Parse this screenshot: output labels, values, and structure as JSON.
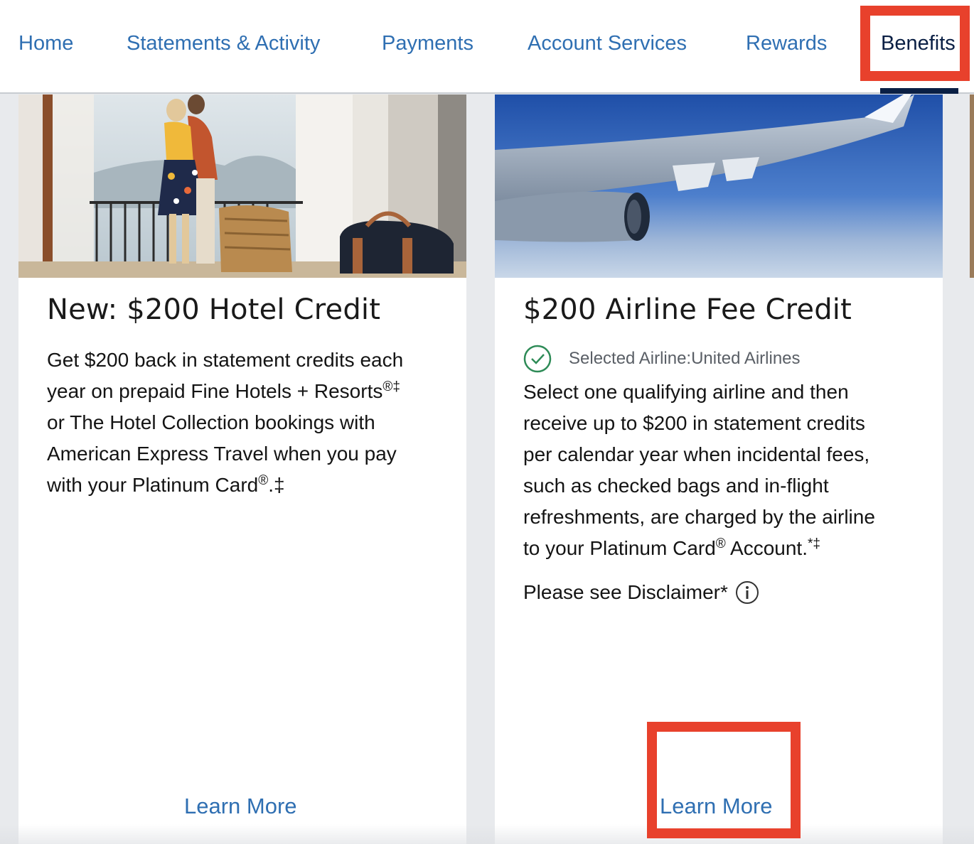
{
  "nav": {
    "items": [
      {
        "label": "Home"
      },
      {
        "label": "Statements & Activity"
      },
      {
        "label": "Payments"
      },
      {
        "label": "Account Services"
      },
      {
        "label": "Rewards"
      },
      {
        "label": "Benefits",
        "active": true
      }
    ]
  },
  "cards": [
    {
      "image": "couple-on-hotel-balcony-photo",
      "title": "New: $200 Hotel Credit",
      "body_lines": [
        "Get $200 back in statement credits each",
        "year on prepaid Fine Hotels + Resorts",
        "®‡",
        "or The Hotel Collection bookings with",
        "American Express Travel when you pay",
        "with your Platinum Card",
        "®",
        ".‡"
      ],
      "learn_more": "Learn More"
    },
    {
      "image": "airplane-wing-photo",
      "title": "$200 Airline Fee Credit",
      "selected_airline": "Selected Airline:United Airlines",
      "body_lines": [
        "Select one qualifying airline and then",
        "receive up to $200 in statement credits",
        "per calendar year when incidental fees,",
        "such as checked bags and in-flight",
        "refreshments, are charged by the airline",
        "to your Platinum Card",
        "®",
        " Account.",
        "*‡"
      ],
      "disclaimer": "Please see Disclaimer*",
      "learn_more": "Learn More"
    }
  ],
  "colors": {
    "link": "#2f6fb2",
    "active_nav": "#0a1f44",
    "highlight": "#e8412c",
    "check": "#2e8b57"
  }
}
